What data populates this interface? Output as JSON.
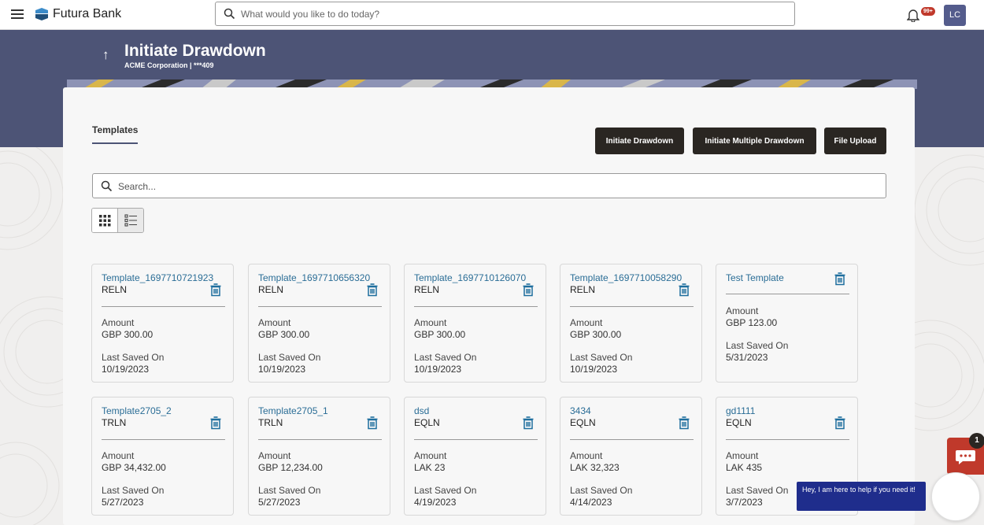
{
  "app": {
    "brand": "Futura Bank",
    "notifications_badge": "99+",
    "avatar_initials": "LC",
    "search_placeholder": "What would you like to do today?"
  },
  "header": {
    "title": "Initiate Drawdown",
    "subtitle": "ACME Corporation | ***409",
    "color": "#4d5476"
  },
  "tabs": [
    {
      "label": "Templates"
    }
  ],
  "actions": {
    "initiate_drawdown": "Initiate Drawdown",
    "initiate_multiple": "Initiate Multiple Drawdown",
    "file_upload": "File Upload"
  },
  "search": {
    "placeholder": "Search..."
  },
  "cards": [
    {
      "name": "Template_1697710721923",
      "type": "RELN",
      "amount_label": "Amount",
      "amount": "GBP 300.00",
      "date_label": "Last Saved On",
      "date": "10/19/2023"
    },
    {
      "name": "Template_1697710656320",
      "type": "RELN",
      "amount_label": "Amount",
      "amount": "GBP 300.00",
      "date_label": "Last Saved On",
      "date": "10/19/2023"
    },
    {
      "name": "Template_1697710126070",
      "type": "RELN",
      "amount_label": "Amount",
      "amount": "GBP 300.00",
      "date_label": "Last Saved On",
      "date": "10/19/2023"
    },
    {
      "name": "Template_1697710058290",
      "type": "RELN",
      "amount_label": "Amount",
      "amount": "GBP 300.00",
      "date_label": "Last Saved On",
      "date": "10/19/2023"
    },
    {
      "name": "Test Template",
      "type": "",
      "amount_label": "Amount",
      "amount": "GBP 123.00",
      "date_label": "Last Saved On",
      "date": "5/31/2023"
    },
    {
      "name": "Template2705_2",
      "type": "TRLN",
      "amount_label": "Amount",
      "amount": "GBP 34,432.00",
      "date_label": "Last Saved On",
      "date": "5/27/2023"
    },
    {
      "name": "Template2705_1",
      "type": "TRLN",
      "amount_label": "Amount",
      "amount": "GBP 12,234.00",
      "date_label": "Last Saved On",
      "date": "5/27/2023"
    },
    {
      "name": "dsd",
      "type": "EQLN",
      "amount_label": "Amount",
      "amount": "LAK 23",
      "date_label": "Last Saved On",
      "date": "4/19/2023"
    },
    {
      "name": "3434",
      "type": "EQLN",
      "amount_label": "Amount",
      "amount": "LAK 32,323",
      "date_label": "Last Saved On",
      "date": "4/14/2023"
    },
    {
      "name": "gd1111",
      "type": "EQLN",
      "amount_label": "Amount",
      "amount": "LAK 435",
      "date_label": "Last Saved On",
      "date": "3/7/2023"
    }
  ],
  "chat": {
    "count": "1",
    "message": "Hey, I am here to help if you need it!"
  },
  "icons": {
    "menu": "hamburger-icon",
    "search": "search-icon",
    "bell": "bell-icon",
    "back": "back-arrow-icon",
    "grid": "grid-view-icon",
    "list": "list-view-icon",
    "delete": "trash-icon",
    "chat": "chat-icon"
  }
}
